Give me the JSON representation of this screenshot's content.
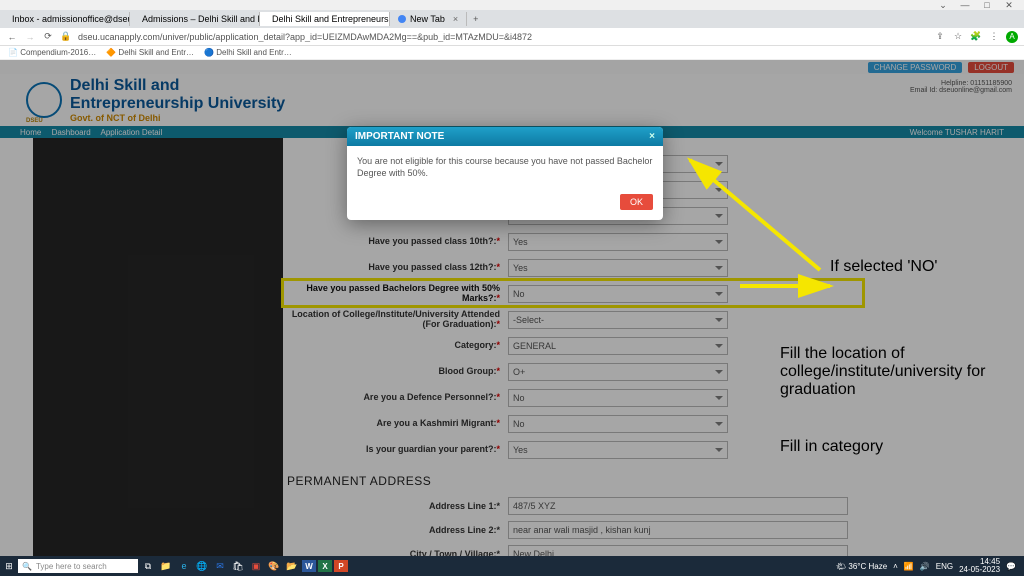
{
  "window": {
    "min": "—",
    "max": "□",
    "close": "✕"
  },
  "tabs": [
    {
      "label": "Inbox - admissionoffice@dseu…",
      "fav": "#d44"
    },
    {
      "label": "Admissions – Delhi Skill and Ent…",
      "fav": "#0a73b7"
    },
    {
      "label": "Delhi Skill and Entrepreneurship",
      "fav": "#f5a623",
      "active": true
    },
    {
      "label": "New Tab",
      "fav": "#4285f4"
    }
  ],
  "address": {
    "back": "←",
    "fwd": "→",
    "reload": "⟳",
    "lock": "🔒",
    "url": "dseu.ucanapply.com/univer/public/application_detail?app_id=UEIZMDAwMDA2Mg==&pub_id=MTAzMDU=&i4872",
    "share": "⇪",
    "star": "☆",
    "ext": "🧩",
    "menu": "⋮",
    "avatar": "A"
  },
  "bookmarks": [
    "Compendium-2016…",
    "Delhi Skill and Entr…",
    "Delhi Skill and Entr…"
  ],
  "topbtns": {
    "chpw": "CHANGE PASSWORD",
    "logout": "LOGOUT"
  },
  "uni": {
    "l1": "Delhi Skill and",
    "l2": "Entrepreneurship University",
    "l3": "Govt. of NCT of Delhi"
  },
  "help": {
    "l1": "Helpline: 01151185900",
    "l2": "Email Id:  dseuonline@gmail.com"
  },
  "crumbs": {
    "a": "Home",
    "b": "Dashboard",
    "c": "Application Detail",
    "welcome": "Welcome TUSHAR HARIT"
  },
  "form": {
    "r1": {
      "lbl": "",
      "val": ""
    },
    "r2": {
      "lbl": "",
      "val": ""
    },
    "r3": {
      "lbl": "",
      "val": ""
    },
    "class10": {
      "lbl": "Have you passed class 10th?:",
      "val": "Yes"
    },
    "class12": {
      "lbl": "Have you passed class 12th?:",
      "val": "Yes"
    },
    "bach": {
      "lbl": "Have you passed Bachelors Degree with 50% Marks?:",
      "val": "No"
    },
    "loc": {
      "lbl": "Location of College/Institute/University Attended (For Graduation):",
      "val": "-Select-"
    },
    "cat": {
      "lbl": "Category:",
      "val": "GENERAL"
    },
    "blood": {
      "lbl": "Blood Group:",
      "val": "O+"
    },
    "def": {
      "lbl": "Are you a Defence Personnel?:",
      "val": "No"
    },
    "kash": {
      "lbl": "Are you a Kashmiri Migrant:",
      "val": "No"
    },
    "guard": {
      "lbl": "Is your guardian your parent?:",
      "val": "Yes"
    }
  },
  "addr": {
    "title": "Permanent address",
    "l1": {
      "lbl": "Address Line 1:",
      "val": "487/5 XYZ"
    },
    "l2": {
      "lbl": "Address Line 2:",
      "val": "near anar wali masjid , kishan kunj"
    },
    "city": {
      "lbl": "City / Town / Village:",
      "val": "New Delhi"
    }
  },
  "modal": {
    "title": "IMPORTANT NOTE",
    "body": "You are not eligible for this course because you have not passed Bachelor Degree with 50%.",
    "ok": "OK",
    "x": "×"
  },
  "anno": {
    "t1": "If selected 'NO'",
    "t2": "Fill the location of college/institute/university for graduation",
    "t3": "Fill in category"
  },
  "taskbar": {
    "search": "Type here to search",
    "weather": "🌤 36°C Haze",
    "lang": "ENG",
    "time": "14:45",
    "date": "24-05-2023"
  }
}
